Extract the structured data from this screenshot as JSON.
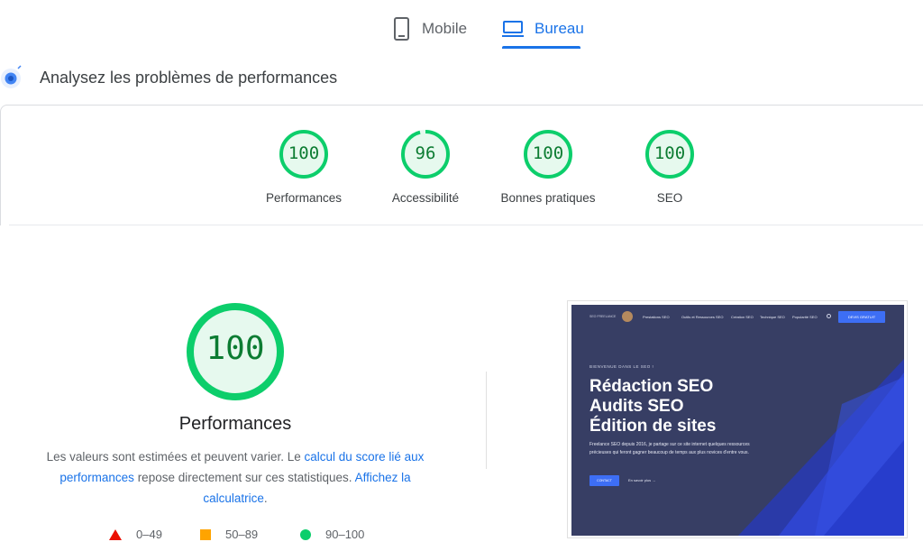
{
  "tabs": {
    "mobile_label": "Mobile",
    "desktop_label": "Bureau",
    "active": "Bureau"
  },
  "section": {
    "title": "Analysez les problèmes de performances"
  },
  "categories": [
    {
      "label": "Performances",
      "score": "100"
    },
    {
      "label": "Accessibilité",
      "score": "96"
    },
    {
      "label": "Bonnes pratiques",
      "score": "100"
    },
    {
      "label": "SEO",
      "score": "100"
    }
  ],
  "performance": {
    "score": "100",
    "title": "Performances",
    "desc_part1": "Les valeurs sont estimées et peuvent varier. Le ",
    "desc_link1": "calcul du score lié aux performances",
    "desc_part2": " repose directement sur ces statistiques. ",
    "desc_link2": "Affichez la calculatrice",
    "desc_end": "."
  },
  "legend": {
    "fail": "0–49",
    "average": "50–89",
    "pass": "90–100"
  },
  "colors": {
    "accent": "#1a73e8",
    "pass": "#0cce6b",
    "pass_text": "#0c7c32",
    "average": "#ffa400",
    "fail": "#eb0f00"
  },
  "screenshot": {
    "nav_items": [
      "Prestations SEO",
      "Outils et Ressources SEO",
      "Création SEO",
      "Technique SEO",
      "Popularité SEO"
    ],
    "nav_cta": "DEVIS GRATUIT",
    "kicker": "BIENVENUE DANS LE SEO !",
    "headline_1": "Rédaction SEO",
    "headline_2": "Audits SEO",
    "headline_3": "Édition de sites",
    "paragraph": "Freelance SEO depuis 2016, je partage sur ce site internet quelques ressources précieuses qui feront gagner beaucoup de temps aux plus novices d'entre vous.",
    "cta": "CONTACT",
    "link": "En savoir plus →"
  }
}
